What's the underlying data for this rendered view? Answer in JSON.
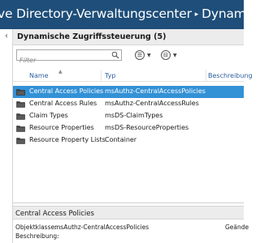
{
  "window": {
    "title_part1": "ve Directory-Verwaltungscenter",
    "title_separator": "▸",
    "title_part2": "Dynamische Zugri"
  },
  "nav": {
    "collapse_glyph": "‹"
  },
  "section": {
    "title": "Dynamische Zugriffssteuerung  (5)"
  },
  "toolbar": {
    "filter_placeholder": "Filter",
    "view_button_glyph": "☰",
    "save_query_glyph": "⊟",
    "dropdown_glyph": "▼"
  },
  "grid": {
    "columns": [
      {
        "label": "Name"
      },
      {
        "label": "Typ"
      },
      {
        "label": "Beschreibung"
      }
    ],
    "sort_glyph": "▲",
    "rows": [
      {
        "name": "Central Access Policies",
        "type": "msAuthz-CentralAccessPolicies",
        "selected": true
      },
      {
        "name": "Central Access Rules",
        "type": "msAuthz-CentralAccessRules",
        "selected": false
      },
      {
        "name": "Claim Types",
        "type": "msDS-ClaimTypes",
        "selected": false
      },
      {
        "name": "Resource Properties",
        "type": "msDS-ResourceProperties",
        "selected": false
      },
      {
        "name": "Resource Property Lists",
        "type": "Container",
        "selected": false
      }
    ]
  },
  "details": {
    "title": "Central Access Policies",
    "object_class_label": "Objektklasse:",
    "object_class_value": "msAuthz-CentralAccessPolicies",
    "modified_label": "Geände",
    "description_label": "Beschreibung:"
  },
  "colors": {
    "titlebar": "#1e4e79",
    "selection": "#3391d6",
    "header_link": "#2d5f9e",
    "folder": "#404040"
  }
}
